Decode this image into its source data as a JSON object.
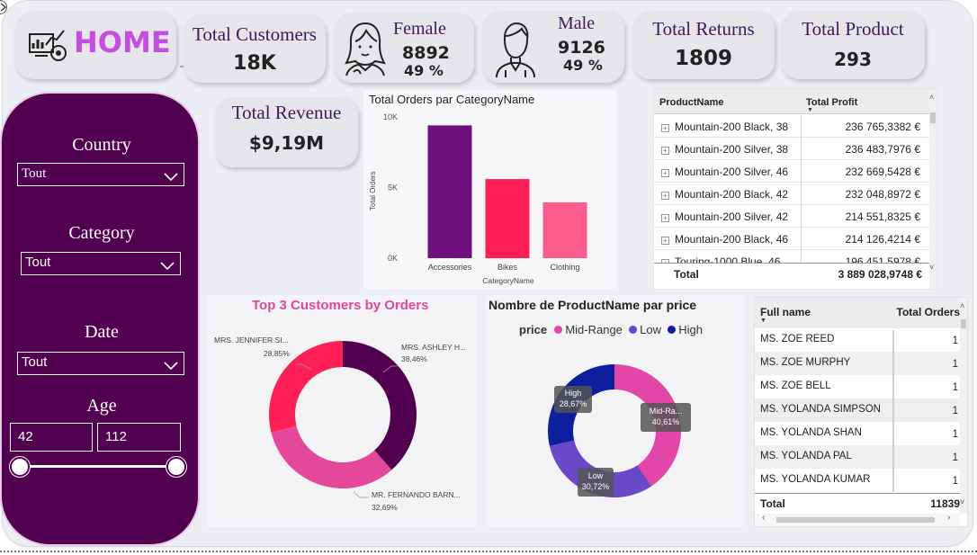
{
  "header": {
    "home_label": "HOME"
  },
  "kpis": {
    "total_customers": {
      "title": "Total Customers",
      "value": "18K"
    },
    "female": {
      "title": "Female",
      "count": "8892",
      "pct": "49 %"
    },
    "male": {
      "title": "Male",
      "count": "9126",
      "pct": "49 %"
    },
    "total_returns": {
      "title": "Total Returns",
      "value": "1809"
    },
    "total_product": {
      "title": "Total Product",
      "value": "293"
    },
    "total_revenue": {
      "title": "Total Revenue",
      "value": "$9,19M"
    }
  },
  "filters": {
    "country": {
      "label": "Country",
      "value": "Tout"
    },
    "category": {
      "label": "Category",
      "value": "Tout"
    },
    "date": {
      "label": "Date",
      "value": "Tout"
    },
    "age": {
      "label": "Age",
      "min": "42",
      "max": "112"
    }
  },
  "colors": {
    "sidebar": "#520050",
    "accent_purple": "#6e0f7f",
    "accent_red": "#ff1f57",
    "accent_pink": "#ff5d90",
    "donut_dark": "#520050",
    "donut_pink": "#e3489b",
    "mid_range": "#e146a8",
    "low": "#6a49c9",
    "high": "#0d1f9e"
  },
  "chart_data": [
    {
      "type": "bar",
      "title": "Total Orders par CategoryName",
      "xlabel": "CategoryName",
      "ylabel": "Total Orders",
      "ylim": [
        0,
        10000
      ],
      "yticks": [
        "0K",
        "5K",
        "10K"
      ],
      "categories": [
        "Accessories",
        "Bikes",
        "Clothing"
      ],
      "values": [
        9400,
        5600,
        3950
      ]
    },
    {
      "type": "pie",
      "title": "Top 3 Customers by Orders",
      "labels": [
        "MRS. ASHLEY H...",
        "MR. FERNANDO BARN...",
        "MRS. JENNIFER SI..."
      ],
      "pct_labels": [
        "38,46%",
        "32,69%",
        "28,85%"
      ],
      "values": [
        38.46,
        32.69,
        28.85
      ]
    },
    {
      "type": "pie",
      "title": "Nombre de ProductName par price",
      "legend_title": "price",
      "legend": [
        "Mid-Range",
        "Low",
        "High"
      ],
      "labels": [
        "Mid-Ra...",
        "Low",
        "High"
      ],
      "pct_labels": [
        "40,61%",
        "30,72%",
        "28,67%"
      ],
      "values": [
        40.61,
        30.72,
        28.67
      ]
    }
  ],
  "product_table": {
    "columns": [
      "ProductName",
      "Total Profit"
    ],
    "rows": [
      {
        "name": "Mountain-200 Black, 38",
        "profit": "236 765,3382 €"
      },
      {
        "name": "Mountain-200 Silver, 38",
        "profit": "236 483,7976 €"
      },
      {
        "name": "Mountain-200 Silver, 46",
        "profit": "232 669,5428 €"
      },
      {
        "name": "Mountain-200 Black, 42",
        "profit": "232 048,8972 €"
      },
      {
        "name": "Mountain-200 Silver, 42",
        "profit": "214 551,8325 €"
      },
      {
        "name": "Mountain-200 Black, 46",
        "profit": "214 126,4214 €"
      },
      {
        "name": "Touring-1000 Blue, 46",
        "profit": "196 451,5978 €"
      }
    ],
    "total_label": "Total",
    "total_value": "3 889 028,9748 €"
  },
  "customer_table": {
    "columns": [
      "Full name",
      "Total Orders"
    ],
    "rows": [
      {
        "name": "MS. ZOE REED",
        "orders": "1"
      },
      {
        "name": "MS. ZOE MURPHY",
        "orders": "1"
      },
      {
        "name": "MS. ZOE BELL",
        "orders": "1"
      },
      {
        "name": "MS. YOLANDA SIMPSON",
        "orders": "1"
      },
      {
        "name": "MS. YOLANDA SHAN",
        "orders": "1"
      },
      {
        "name": "MS. YOLANDA PAL",
        "orders": "1"
      },
      {
        "name": "MS. YOLANDA KUMAR",
        "orders": "1"
      }
    ],
    "total_label": "Total",
    "total_value": "11839"
  }
}
